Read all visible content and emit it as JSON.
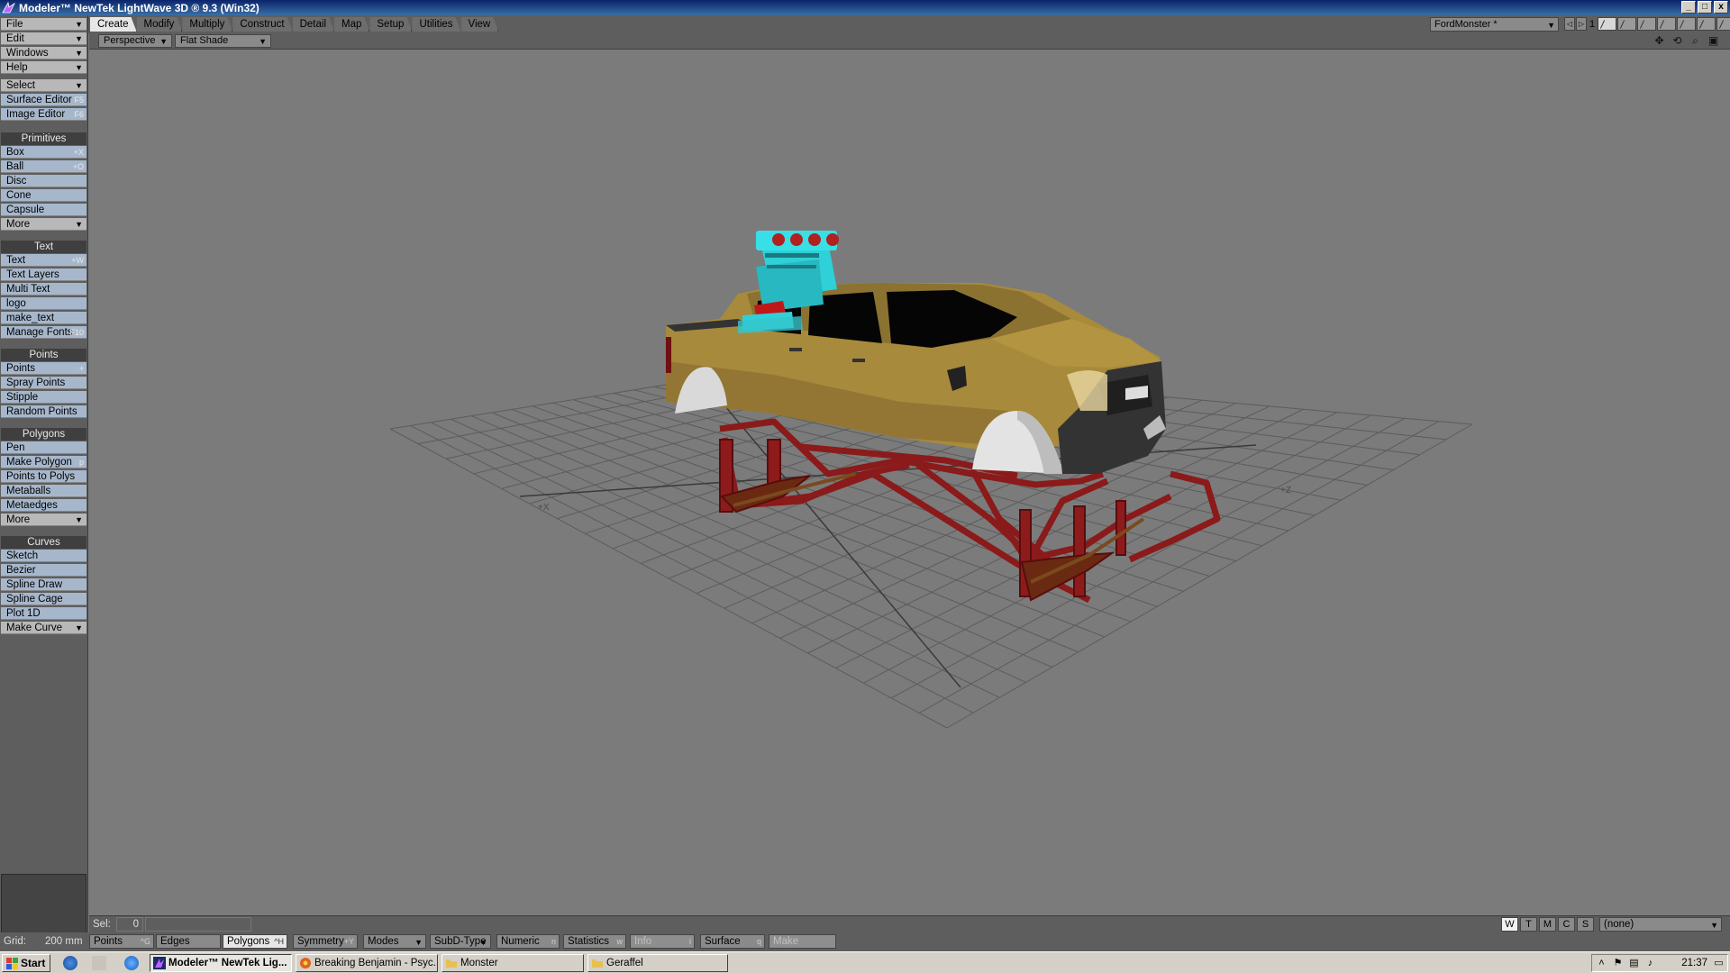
{
  "window": {
    "title": "Modeler™ NewTek LightWave 3D ® 9.3 (Win32)",
    "min": "_",
    "max": "□",
    "close": "x"
  },
  "tabs": [
    {
      "label": "Create",
      "active": true
    },
    {
      "label": "Modify"
    },
    {
      "label": "Multiply"
    },
    {
      "label": "Construct"
    },
    {
      "label": "Detail"
    },
    {
      "label": "Map"
    },
    {
      "label": "Setup"
    },
    {
      "label": "Utilities"
    },
    {
      "label": "View"
    }
  ],
  "object_selector": {
    "value": "FordMonster *"
  },
  "layers": {
    "current": "1"
  },
  "left_menus": {
    "file": "File",
    "edit": "Edit",
    "windows": "Windows",
    "help": "Help",
    "select": "Select",
    "surface_editor": "Surface Editor",
    "surface_editor_key": "F5",
    "image_editor": "Image Editor",
    "image_editor_key": "F6"
  },
  "primitives": {
    "header": "Primitives",
    "box": "Box",
    "box_key": "+X",
    "ball": "Ball",
    "ball_key": "+O",
    "disc": "Disc",
    "cone": "Cone",
    "capsule": "Capsule",
    "more": "More"
  },
  "text_group": {
    "header": "Text",
    "text": "Text",
    "text_key": "+W",
    "text_layers": "Text Layers",
    "multi_text": "Multi Text",
    "logo": "logo",
    "make_text": "make_text",
    "manage_fonts": "Manage Fonts",
    "manage_fonts_key": "F10"
  },
  "points_group": {
    "header": "Points",
    "points": "Points",
    "points_key": "+",
    "spray_points": "Spray Points",
    "stipple": "Stipple",
    "random_points": "Random Points"
  },
  "polygons_group": {
    "header": "Polygons",
    "pen": "Pen",
    "make_polygon": "Make Polygon",
    "make_polygon_key": "p",
    "points_to_polys": "Points to Polys",
    "metaballs": "Metaballs",
    "metaedges": "Metaedges",
    "more": "More"
  },
  "curves_group": {
    "header": "Curves",
    "sketch": "Sketch",
    "bezier": "Bezier",
    "spline_draw": "Spline Draw",
    "spline_cage": "Spline Cage",
    "plot_1d": "Plot 1D",
    "make_curve": "Make Curve"
  },
  "viewport": {
    "view_type": "Perspective",
    "render_mode": "Flat Shade",
    "axis_x": "+X",
    "axis_z": "+Z"
  },
  "status": {
    "sel_label": "Sel:",
    "sel_value": "0",
    "wtmcs": [
      "W",
      "T",
      "M",
      "C",
      "S"
    ],
    "wtmcs_on": "W",
    "vmap": "(none)"
  },
  "bottom_bar": {
    "grid_label": "Grid:",
    "grid_value": "200 mm",
    "points": "Points",
    "points_key": "^G",
    "edges": "Edges",
    "polygons": "Polygons",
    "polygons_key": "^H",
    "symmetry": "Symmetry",
    "symmetry_key": "+Y",
    "modes": "Modes",
    "subd_type": "SubD-Type",
    "numeric": "Numeric",
    "numeric_key": "n",
    "statistics": "Statistics",
    "statistics_key": "w",
    "info": "Info",
    "info_key": "i",
    "surface": "Surface",
    "surface_key": "q",
    "make": "Make"
  },
  "taskbar": {
    "start": "Start",
    "tasks": [
      {
        "label": "Modeler™ NewTek Lig...",
        "active": true
      },
      {
        "label": "Breaking Benjamin - Psyc..."
      },
      {
        "label": "Monster"
      },
      {
        "label": "Geraffel"
      }
    ],
    "clock": "21:37"
  },
  "colors": {
    "body": "#a88a3c",
    "body_dark": "#7a6228",
    "frame": "#8b1a1a",
    "engine": "#2ec8d0",
    "panel_blue": "#a6b7cc"
  }
}
